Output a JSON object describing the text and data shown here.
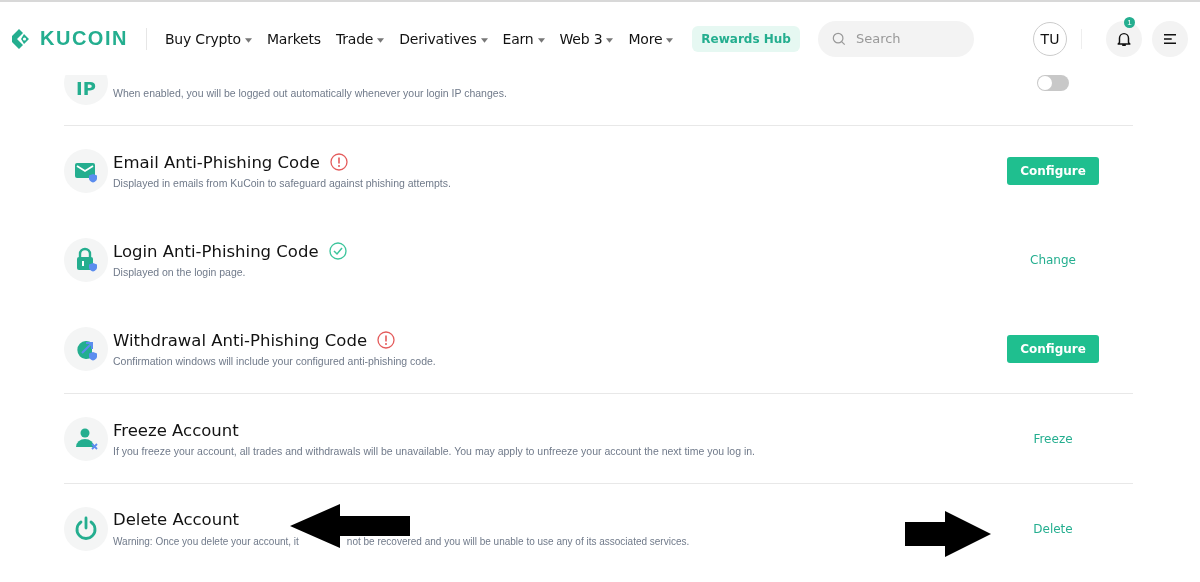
{
  "header": {
    "logo": "KUCOIN",
    "nav": [
      {
        "label": "Buy Crypto",
        "dropdown": true
      },
      {
        "label": "Markets",
        "dropdown": false
      },
      {
        "label": "Trade",
        "dropdown": true
      },
      {
        "label": "Derivatives",
        "dropdown": true
      },
      {
        "label": "Earn",
        "dropdown": true
      },
      {
        "label": "Web 3",
        "dropdown": true
      },
      {
        "label": "More",
        "dropdown": true
      }
    ],
    "rewards": "Rewards Hub",
    "search": {
      "placeholder": "Search"
    },
    "avatar": "TU",
    "notification_count": "1"
  },
  "partial_row": {
    "icon_text": "IP",
    "description": "When enabled, you will be logged out automatically whenever your login IP changes.",
    "toggle": {
      "on": false
    }
  },
  "settings": [
    {
      "title": "Email Anti-Phishing Code",
      "verified": false,
      "description": "Displayed in emails from KuCoin to safeguard against phishing attempts.",
      "action": {
        "kind": "button",
        "label": "Configure"
      },
      "divider_after": false
    },
    {
      "title": "Login Anti-Phishing Code",
      "verified": true,
      "description": "Displayed on the login page.",
      "action": {
        "kind": "link",
        "label": "Change"
      },
      "divider_after": false
    },
    {
      "title": "Withdrawal Anti-Phishing Code",
      "verified": false,
      "description": "Confirmation windows will include your configured anti-phishing code.",
      "action": {
        "kind": "button",
        "label": "Configure"
      },
      "divider_after": true
    },
    {
      "title": "Freeze Account",
      "description": "If you freeze your account, all trades and withdrawals will be unavailable. You may apply to unfreeze your account the next time you log in.",
      "action": {
        "kind": "link",
        "label": "Freeze"
      },
      "divider_after": true
    },
    {
      "title": "Delete Account",
      "description_parts": [
        "Warning: Once you delete your account, it",
        "not be recovered and you will be unable to use any of its associated services."
      ],
      "action": {
        "kind": "link",
        "label": "Delete"
      },
      "divider_after": false
    }
  ]
}
